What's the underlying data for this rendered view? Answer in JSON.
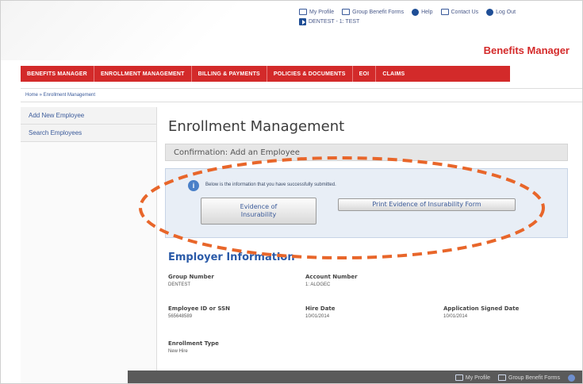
{
  "utility": {
    "my_profile": "My Profile",
    "group_forms": "Group Benefit Forms",
    "help": "Help",
    "contact": "Contact Us",
    "logout": "Log Out",
    "account": "DENTEST - 1: TEST"
  },
  "brand": {
    "title": "Benefits Manager"
  },
  "nav": {
    "items": [
      "BENEFITS MANAGER",
      "ENROLLMENT MANAGEMENT",
      "BILLING & PAYMENTS",
      "POLICIES & DOCUMENTS",
      "EOI",
      "CLAIMS"
    ]
  },
  "breadcrumb": {
    "text": "Home » Enrollment Management"
  },
  "sidebar": {
    "items": [
      "Add New Employee",
      "Search Employees"
    ]
  },
  "main": {
    "title": "Enrollment Management",
    "confirmation": "Confirmation: Add an Employee",
    "info_message": "Below is the information that you have successfully submitted.",
    "eoi_button": "Evidence of Insurability",
    "print_button": "Print Evidence of Insurability Form",
    "section_title": "Employer Information",
    "fields": {
      "group_number": {
        "label": "Group Number",
        "value": "DENTEST"
      },
      "account_number": {
        "label": "Account Number",
        "value": "1: ALOGEC"
      },
      "employee_id": {
        "label": "Employee ID or SSN",
        "value": "565648589"
      },
      "hire_date": {
        "label": "Hire Date",
        "value": "10/01/2014"
      },
      "app_signed_date": {
        "label": "Application Signed Date",
        "value": "10/01/2014"
      },
      "enrollment_type": {
        "label": "Enrollment Type",
        "value": "New Hire"
      }
    }
  },
  "bottom_bar": {
    "my_profile": "My Profile",
    "group_forms": "Group Benefit Forms"
  },
  "colors": {
    "nav_red": "#d32a2a",
    "brand_red": "#d42a2a",
    "link_blue": "#3a5a9a",
    "highlight_orange": "#e8662a"
  }
}
